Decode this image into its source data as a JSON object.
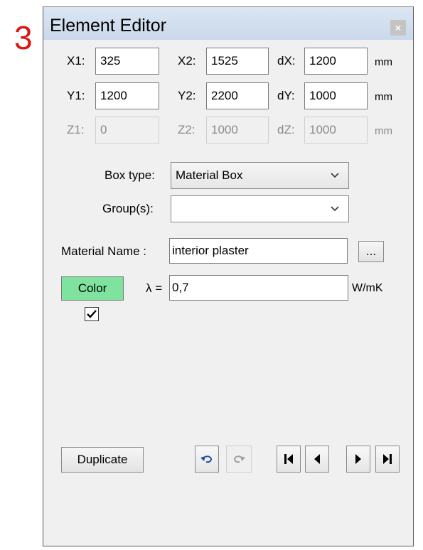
{
  "step_marker": "3",
  "window": {
    "title": "Element Editor",
    "close_glyph": "×"
  },
  "coords": {
    "x1": {
      "label": "X1:",
      "value": "325"
    },
    "x2": {
      "label": "X2:",
      "value": "1525"
    },
    "dx": {
      "label": "dX:",
      "value": "1200"
    },
    "x_unit": "mm",
    "y1": {
      "label": "Y1:",
      "value": "1200"
    },
    "y2": {
      "label": "Y2:",
      "value": "2200"
    },
    "dy": {
      "label": "dY:",
      "value": "1000"
    },
    "y_unit": "mm",
    "z1": {
      "label": "Z1:",
      "value": "0"
    },
    "z2": {
      "label": "Z2:",
      "value": "1000"
    },
    "dz": {
      "label": "dZ:",
      "value": "1000"
    },
    "z_unit": "mm"
  },
  "box_type": {
    "label": "Box type:",
    "value": "Material Box"
  },
  "groups": {
    "label": "Group(s):",
    "value": ""
  },
  "material": {
    "label": "Material Name :",
    "value": "interior plaster",
    "browse_label": "..."
  },
  "color_button": {
    "label": "Color",
    "color": "#7fe39f"
  },
  "lambda": {
    "label": "λ =",
    "value": "0,7",
    "unit": "W/mK"
  },
  "checkbox": {
    "checked": true
  },
  "buttons": {
    "duplicate": "Duplicate",
    "undo_icon": "undo-icon",
    "redo_icon": "redo-icon",
    "first_icon": "first-record-icon",
    "prev_icon": "previous-record-icon",
    "next_icon": "next-record-icon",
    "last_icon": "last-record-icon"
  }
}
